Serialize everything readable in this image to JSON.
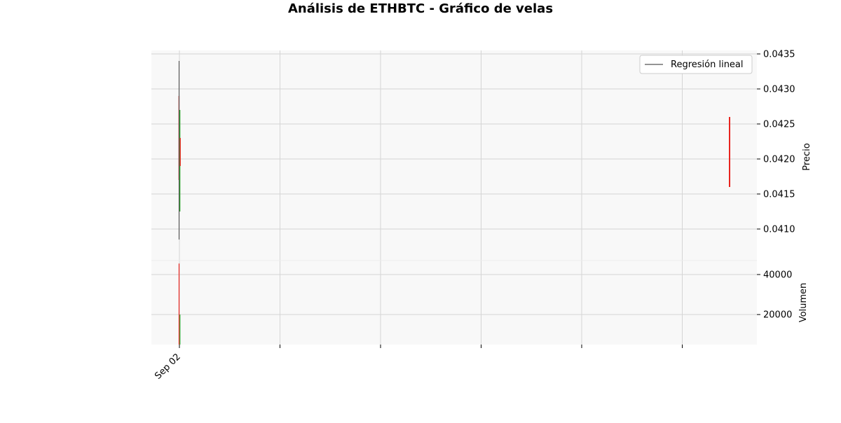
{
  "chart_data": {
    "title": "Análisis de ETHBTC - Gráfico de velas",
    "x_tick_labels": [
      "Sep 02"
    ],
    "colors": {
      "up": "#2ca02c",
      "down": "#e8251f",
      "regression": "#555555",
      "panel_bg": "#f8f8f8",
      "grid": "#d5d5d5"
    },
    "price_panel": {
      "type": "candlestick",
      "ylabel": "Precio",
      "ylim": [
        0.04055,
        0.04355
      ],
      "yticks": [
        "0.0410",
        "0.0415",
        "0.0420",
        "0.0425",
        "0.0430",
        "0.0435"
      ],
      "yaxis_side": "right",
      "grid": true,
      "legend": {
        "position": "top-right",
        "entries": [
          "Regresión lineal"
        ]
      },
      "candles": [
        {
          "x": "Sep 02",
          "open": 0.0418,
          "high": 0.0429,
          "low": 0.0417,
          "close": 0.0419,
          "direction": "down"
        },
        {
          "x": "Sep 02",
          "open": 0.0413,
          "high": 0.0427,
          "low": 0.04125,
          "close": 0.0417,
          "direction": "up"
        },
        {
          "x": "Sep 02",
          "open": 0.0421,
          "high": 0.0423,
          "low": 0.0419,
          "close": 0.0418,
          "direction": "down"
        }
      ],
      "outlier_candle": {
        "open": 0.0426,
        "high": 0.0426,
        "low": 0.0416,
        "close": 0.0416,
        "direction": "down"
      },
      "regression_line": {
        "x": "Sep 02",
        "from": 0.0434,
        "to": 0.04085
      }
    },
    "volume_panel": {
      "type": "bar",
      "ylabel": "Volumen",
      "ylim": [
        5000,
        47000
      ],
      "yticks": [
        "20000",
        "40000"
      ],
      "yaxis_side": "right",
      "grid": true,
      "bars": [
        {
          "x": "Sep 02",
          "value": 45500,
          "direction": "down"
        },
        {
          "x": "Sep 02",
          "value": 20000,
          "direction": "up"
        }
      ]
    }
  }
}
